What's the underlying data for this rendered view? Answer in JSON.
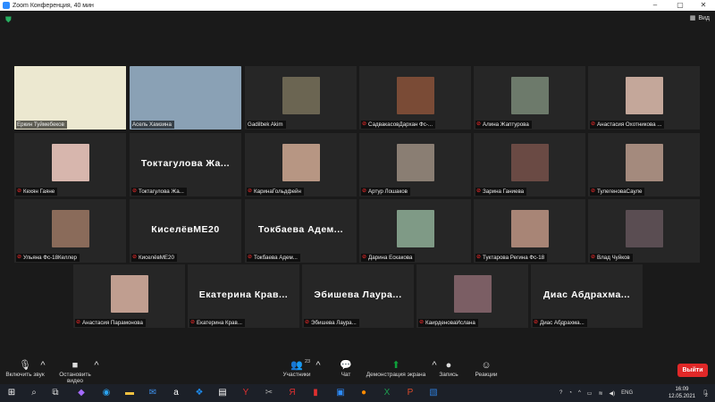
{
  "window": {
    "title": "Zoom Конференция, 40 мин"
  },
  "header": {
    "view_label": "Вид"
  },
  "participants": [
    {
      "name": "Еркин Туймебеков",
      "display": "",
      "muted": false,
      "active": true,
      "bg": "#ece8d0"
    },
    {
      "name": "Асель Хамзина",
      "display": "",
      "muted": false,
      "active": false,
      "bg": "#8aa1b5"
    },
    {
      "name": "Gadilbek Akim",
      "display": "",
      "muted": false,
      "active": false,
      "bg": "#6b6552"
    },
    {
      "name": "СадвакасовДархан Фс-...",
      "display": "",
      "muted": true,
      "active": false,
      "bg": "#7a4b36"
    },
    {
      "name": "Алина Жаптурова",
      "display": "",
      "muted": true,
      "active": false,
      "bg": "#6d7a6b"
    },
    {
      "name": "Анастасия Охотникова ...",
      "display": "",
      "muted": true,
      "active": false,
      "bg": "#c4a79a"
    },
    {
      "name": "Кехян Гаяне",
      "display": "",
      "muted": true,
      "active": false,
      "bg": "#d7b6ad"
    },
    {
      "name": "",
      "display": "Токтагулова Жа...",
      "muted": true,
      "active": false,
      "bg": ""
    },
    {
      "name": "КаринаГольдфейн",
      "display": "",
      "muted": true,
      "active": false,
      "bg": "#b79683"
    },
    {
      "name": "Артур Лошаков",
      "display": "",
      "muted": true,
      "active": false,
      "bg": "#8a7e73"
    },
    {
      "name": "Зарина Ганиева",
      "display": "",
      "muted": true,
      "active": false,
      "bg": "#6a4a44"
    },
    {
      "name": "ТулегеноваСауле",
      "display": "",
      "muted": true,
      "active": false,
      "bg": "#a48a7d"
    },
    {
      "name": "Ульяна Фс-18Келлер",
      "display": "",
      "muted": true,
      "active": false,
      "bg": "#8a6b5a"
    },
    {
      "name": "",
      "display": "КиселёвМЕ20",
      "muted": true,
      "active": false,
      "bg": ""
    },
    {
      "name": "",
      "display": "Токбаева Адем...",
      "muted": true,
      "active": false,
      "bg": ""
    },
    {
      "name": "Дарина Ескакова",
      "display": "",
      "muted": true,
      "active": false,
      "bg": "#7f9a86"
    },
    {
      "name": "Туктарова Регина Фс-18",
      "display": "",
      "muted": true,
      "active": false,
      "bg": "#a88576"
    },
    {
      "name": "Влад Чуйков",
      "display": "",
      "muted": true,
      "active": false,
      "bg": "#5a4d52"
    },
    {
      "name": "Анастасия Парамонова",
      "display": "",
      "muted": true,
      "active": false,
      "bg": "#c09e90"
    },
    {
      "name": "",
      "display": "Екатерина Крав...",
      "muted": true,
      "active": false,
      "bg": ""
    },
    {
      "name": "",
      "display": "Эбишева Лаура...",
      "muted": true,
      "active": false,
      "bg": ""
    },
    {
      "name": "КаирденоваИслана",
      "display": "",
      "muted": true,
      "active": false,
      "bg": "#7b5e64"
    },
    {
      "name": "",
      "display": "Диас Абдрахма...",
      "muted": true,
      "active": false,
      "bg": ""
    }
  ],
  "toolbar": {
    "unmute": "Включить звук",
    "stop_video": "Остановить видео",
    "participants": "Участники",
    "participants_count": "23",
    "chat": "Чат",
    "share": "Демонстрация экрана",
    "record": "Запись",
    "reactions": "Реакции",
    "leave": "Выйти"
  },
  "taskbar": {
    "lang": "ENG",
    "time": "16:09",
    "date": "12.05.2021",
    "notif": "2"
  }
}
